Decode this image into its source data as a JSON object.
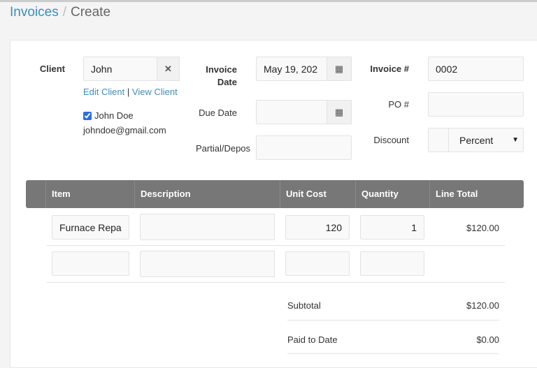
{
  "breadcrumb": {
    "parent": "Invoices",
    "separator": "/",
    "current": "Create"
  },
  "client": {
    "label": "Client",
    "value": "John",
    "clear_icon": "times-icon",
    "edit_link": "Edit Client",
    "link_sep": "|",
    "view_link": "View Client",
    "contact_name": "John Doe",
    "contact_checked": true,
    "contact_email": "johndoe@gmail.com"
  },
  "dates": {
    "invoice_date_label_1": "Invoice",
    "invoice_date_label_2": "Date",
    "invoice_date_value": "May 19, 202",
    "due_date_label": "Due Date",
    "due_date_value": "",
    "partial_label": "Partial/Depos",
    "partial_value": "",
    "calendar_icon": "calendar-icon"
  },
  "meta": {
    "invoice_no_label": "Invoice #",
    "invoice_no_value": "0002",
    "po_label": "PO #",
    "po_value": "",
    "discount_label": "Discount",
    "discount_value": "",
    "discount_type": "Percent"
  },
  "table": {
    "columns": [
      "Item",
      "Description",
      "Unit Cost",
      "Quantity",
      "Line Total"
    ],
    "rows": [
      {
        "item": "Furnace Repa",
        "description": "",
        "unit_cost": "120",
        "quantity": "1",
        "line_total": "$120.00"
      },
      {
        "item": "",
        "description": "",
        "unit_cost": "",
        "quantity": "",
        "line_total": ""
      }
    ]
  },
  "totals": {
    "subtotal_label": "Subtotal",
    "subtotal_value": "$120.00",
    "paid_label": "Paid to Date",
    "paid_value": "$0.00"
  }
}
